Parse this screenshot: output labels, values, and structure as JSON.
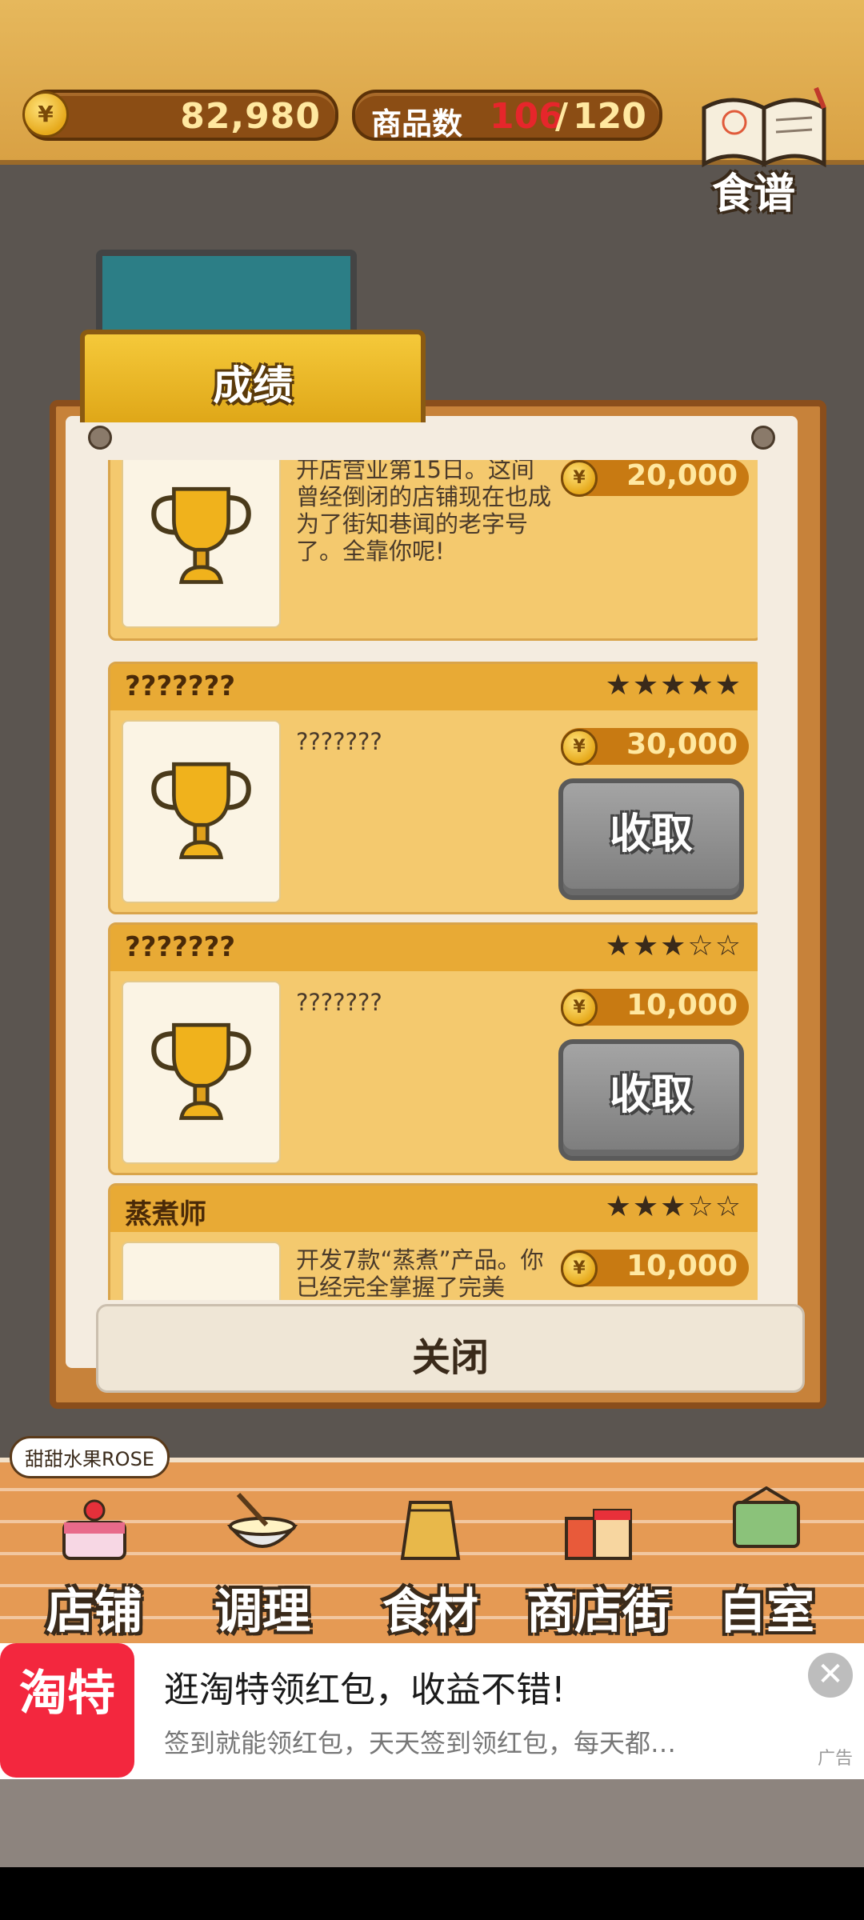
{
  "header": {
    "coins": "82,980",
    "coin_symbol": "¥",
    "goods_label": "商品数",
    "goods_current": "106",
    "goods_sep": "/",
    "goods_max": "120",
    "recipe_label": "食谱"
  },
  "dialog": {
    "tab_title": "成绩",
    "close_label": "关闭",
    "achievements": [
      {
        "title": "",
        "stars": "",
        "desc": "开店营业第15日。这间曾经倒闭的店铺现在也成为了街知巷闻的老字号了。全靠你呢!",
        "reward": "20,000",
        "claim": ""
      },
      {
        "title": "???????",
        "stars": "★★★★★",
        "desc": "???????",
        "reward": "30,000",
        "claim": "收取"
      },
      {
        "title": "???????",
        "stars": "★★★☆☆",
        "desc": "???????",
        "reward": "10,000",
        "claim": "收取"
      },
      {
        "title": "蒸煮师",
        "stars": "★★★☆☆",
        "desc": "开发7款“蒸煮”产品。你已经完全掌握了完美",
        "reward": "10,000",
        "claim": ""
      }
    ]
  },
  "store_name": "甜甜水果ROSE",
  "nav": [
    {
      "label": "店铺",
      "icon": "cake-icon"
    },
    {
      "label": "调理",
      "icon": "mixing-bowl-icon"
    },
    {
      "label": "食材",
      "icon": "flour-bag-icon"
    },
    {
      "label": "商店街",
      "icon": "shop-street-icon"
    },
    {
      "label": "自室",
      "icon": "staff-only-sign-icon"
    }
  ],
  "ad": {
    "logo_text": "淘特",
    "title": "逛淘特领红包，收益不错!",
    "subtitle": "签到就能领红包，天天签到领红包，每天都…",
    "tag": "广告",
    "close": "✕"
  },
  "colors": {
    "header_bg": "#e6b85c",
    "card_bg": "#f4c96e",
    "card_head": "#e8aa35",
    "goods_current": "#e6262b",
    "ad_red": "#f3273e"
  }
}
